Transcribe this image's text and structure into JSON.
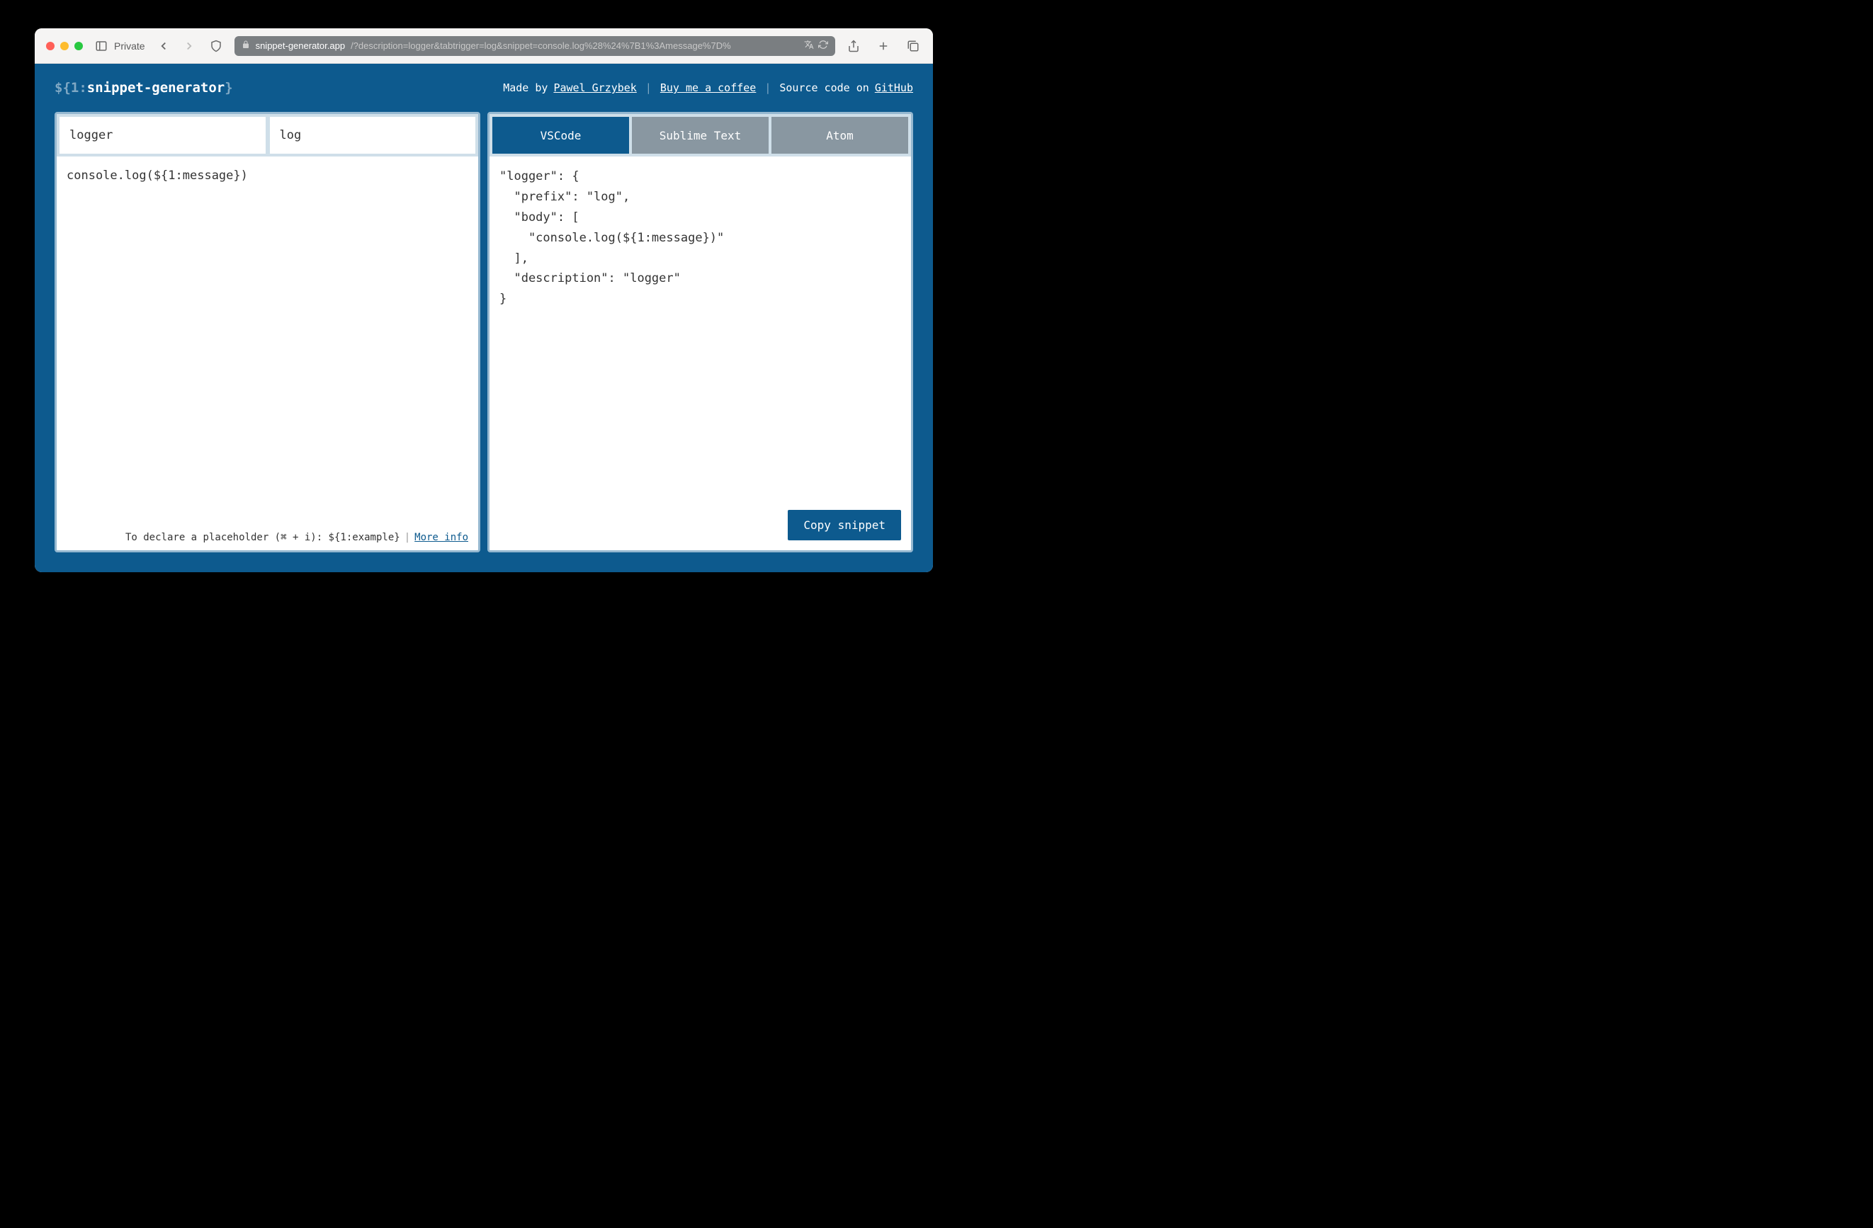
{
  "browser": {
    "private_label": "Private",
    "url_domain": "snippet-generator.app",
    "url_path": "/?description=logger&tabtrigger=log&snippet=console.log%28%24%7B1%3Amessage%7D%"
  },
  "header": {
    "logo_prefix": "${1:",
    "logo_main": "snippet-generator",
    "logo_suffix": "}",
    "made_by_prefix": "Made by ",
    "made_by_link": "Pawel Grzybek",
    "coffee_link": "Buy me a coffee",
    "source_prefix": "Source code on ",
    "source_link": "GitHub"
  },
  "left": {
    "description_value": "logger",
    "trigger_value": "log",
    "snippet_value": "console.log(${1:message})",
    "footer_hint": "To declare a placeholder (⌘ + i): ${1:example}",
    "footer_more": "More info"
  },
  "right": {
    "tabs": {
      "vscode": "VSCode",
      "sublime": "Sublime Text",
      "atom": "Atom"
    },
    "output": "\"logger\": {\n  \"prefix\": \"log\",\n  \"body\": [\n    \"console.log(${1:message})\"\n  ],\n  \"description\": \"logger\"\n}",
    "copy_label": "Copy snippet"
  }
}
